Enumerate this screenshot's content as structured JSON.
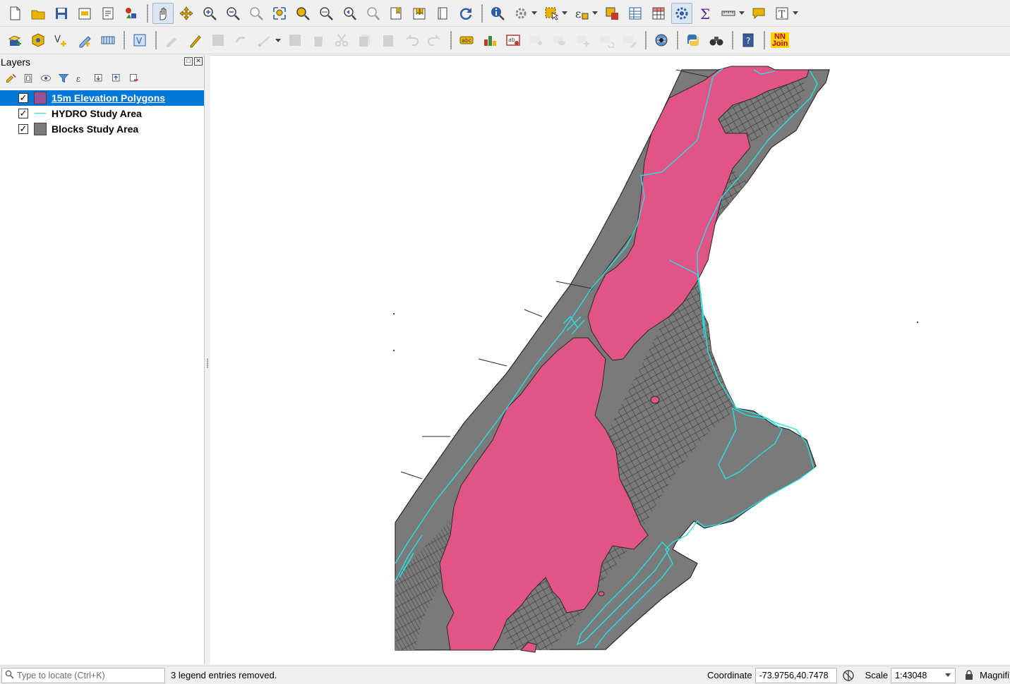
{
  "toolbar1": [
    {
      "name": "new-project-icon"
    },
    {
      "name": "open-project-icon"
    },
    {
      "name": "save-project-icon"
    },
    {
      "name": "new-print-layout-icon"
    },
    {
      "name": "layout-manager-icon"
    },
    {
      "name": "style-manager-icon"
    },
    {
      "sep": true
    },
    {
      "name": "pan-map-icon",
      "active": true
    },
    {
      "name": "pan-to-selection-icon"
    },
    {
      "name": "zoom-in-icon"
    },
    {
      "name": "zoom-out-icon"
    },
    {
      "name": "zoom-native-icon"
    },
    {
      "name": "zoom-full-icon"
    },
    {
      "name": "zoom-to-selection-icon"
    },
    {
      "name": "zoom-to-layer-icon"
    },
    {
      "name": "zoom-last-icon"
    },
    {
      "name": "zoom-next-icon"
    },
    {
      "name": "new-bookmark-icon"
    },
    {
      "name": "show-bookmarks-icon"
    },
    {
      "name": "temporal-controller-icon"
    },
    {
      "name": "refresh-icon"
    },
    {
      "sep": true
    },
    {
      "name": "identify-features-icon"
    },
    {
      "name": "run-feature-action-icon",
      "drop": true
    },
    {
      "name": "select-features-icon",
      "drop": true
    },
    {
      "name": "select-by-expression-icon",
      "drop": true
    },
    {
      "name": "deselect-features-icon"
    },
    {
      "name": "open-attribute-table-icon"
    },
    {
      "name": "field-calculator-icon"
    },
    {
      "name": "processing-toolbox-icon",
      "active": true
    },
    {
      "name": "statistical-summary-icon"
    },
    {
      "name": "measure-line-icon",
      "drop": true
    },
    {
      "name": "map-tips-icon"
    },
    {
      "name": "text-annotation-icon",
      "drop": true
    }
  ],
  "toolbar2": [
    {
      "name": "data-source-manager-icon"
    },
    {
      "name": "new-geopackage-layer-icon"
    },
    {
      "name": "new-shapefile-layer-icon"
    },
    {
      "name": "new-spatialite-layer-icon"
    },
    {
      "name": "new-temporary-layer-icon"
    },
    {
      "sep": true
    },
    {
      "name": "new-virtual-layer-icon"
    },
    {
      "sep": true
    },
    {
      "name": "current-edits-icon",
      "disabled": true
    },
    {
      "name": "toggle-editing-icon"
    },
    {
      "name": "save-layer-edits-icon",
      "disabled": true
    },
    {
      "name": "add-feature-icon",
      "disabled": true
    },
    {
      "name": "vertex-tool-icon",
      "disabled": true,
      "drop": true
    },
    {
      "name": "modify-attributes-icon",
      "disabled": true
    },
    {
      "name": "delete-selected-icon",
      "disabled": true
    },
    {
      "name": "cut-features-icon",
      "disabled": true
    },
    {
      "name": "copy-features-icon",
      "disabled": true
    },
    {
      "name": "paste-features-icon",
      "disabled": true
    },
    {
      "name": "undo-icon",
      "disabled": true
    },
    {
      "name": "redo-icon",
      "disabled": true
    },
    {
      "sep": true
    },
    {
      "name": "layer-labeling-icon"
    },
    {
      "name": "layer-diagram-icon"
    },
    {
      "name": "highlight-pinned-labels-icon"
    },
    {
      "name": "pin-unpin-labels-icon",
      "disabled": true
    },
    {
      "name": "show-hide-labels-icon",
      "disabled": true
    },
    {
      "name": "move-label-icon",
      "disabled": true
    },
    {
      "name": "rotate-label-icon",
      "disabled": true
    },
    {
      "name": "change-label-icon",
      "disabled": true
    },
    {
      "sep": true
    },
    {
      "name": "quickmapservices-icon"
    },
    {
      "sep": true
    },
    {
      "name": "python-console-icon"
    },
    {
      "name": "search-binoculars-icon"
    },
    {
      "sep": true
    },
    {
      "name": "help-icon"
    },
    {
      "sep": true
    },
    {
      "name": "nn-join-icon",
      "text": "NN\nJoin"
    }
  ],
  "layers_panel": {
    "title": "Layers",
    "tools": [
      "open-layer-styling-icon",
      "add-group-icon",
      "manage-visibility-icon",
      "filter-legend-icon",
      "filter-by-expression-icon",
      "expand-all-icon",
      "collapse-all-icon",
      "remove-layer-icon"
    ],
    "layers": [
      {
        "name": "15m Elevation Polygons",
        "checked": true,
        "selected": true,
        "symbol": "fill",
        "color": "#9b4f96"
      },
      {
        "name": "HYDRO Study Area",
        "checked": true,
        "selected": false,
        "symbol": "line",
        "color": "#00e5e5"
      },
      {
        "name": "Blocks Study Area",
        "checked": true,
        "selected": false,
        "symbol": "fill",
        "color": "#7a7a7a"
      }
    ]
  },
  "map": {
    "blocks_color": "#7a7a7a",
    "elevation_color": "#e05585",
    "hydro_color": "#26e0e0",
    "outline_color": "#2a2a2a"
  },
  "statusbar": {
    "locator_placeholder": "Type to locate (Ctrl+K)",
    "message": "3 legend entries removed.",
    "coordinate_label": "Coordinate",
    "coordinate_value": "-73.9756,40.7478",
    "scale_label": "Scale",
    "scale_value": "1:43048",
    "magnifier_label": "Magnifi"
  }
}
